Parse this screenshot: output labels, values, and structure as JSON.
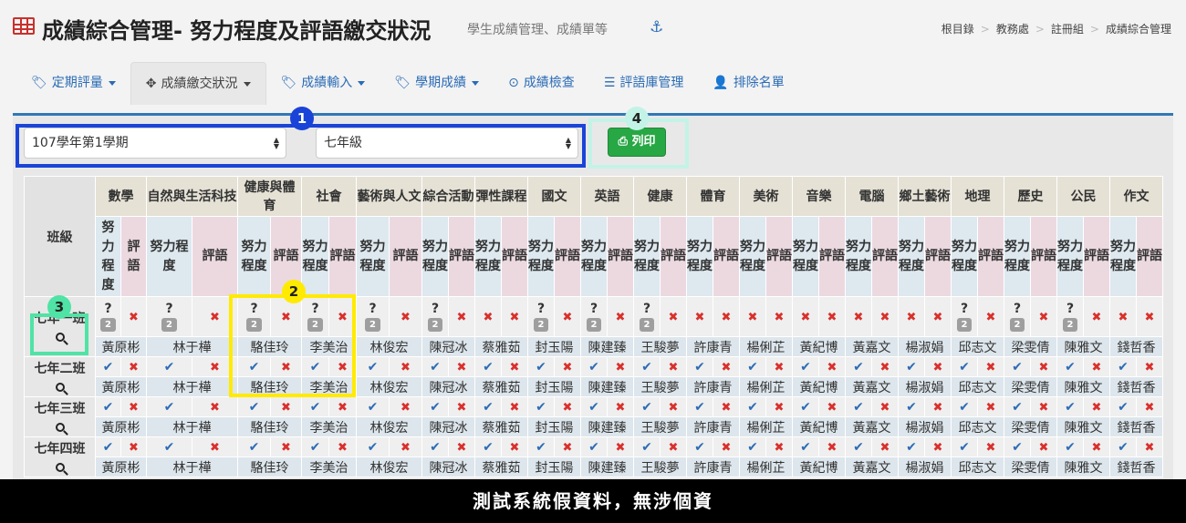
{
  "header": {
    "title": "成績綜合管理- 努力程度及評語繳交狀況",
    "subtitle": "學生成績管理、成績單等",
    "breadcrumb": [
      "根目錄",
      "教務處",
      "註冊組",
      "成績綜合管理"
    ]
  },
  "tabs": [
    {
      "label": "定期評量",
      "icon": "tag-icon",
      "dropdown": true,
      "active": false
    },
    {
      "label": "成績繳交狀況",
      "icon": "crosshairs-icon",
      "dropdown": true,
      "active": true
    },
    {
      "label": "成績輸入",
      "icon": "tag-icon",
      "dropdown": true,
      "active": false
    },
    {
      "label": "學期成績",
      "icon": "tag-icon",
      "dropdown": true,
      "active": false
    },
    {
      "label": "成績檢查",
      "icon": "check-circle-icon",
      "dropdown": false,
      "active": false
    },
    {
      "label": "評語庫管理",
      "icon": "database-icon",
      "dropdown": false,
      "active": false
    },
    {
      "label": "排除名單",
      "icon": "user-times-icon",
      "dropdown": false,
      "active": false
    }
  ],
  "filters": {
    "semester": "107學年第1學期",
    "grade": "七年級"
  },
  "print_label": "列印",
  "badges": {
    "b1": "1",
    "b2": "2",
    "b3": "3",
    "b4": "4"
  },
  "table": {
    "class_header": "班級",
    "effort_label": "努力程度",
    "comment_label": "評語",
    "subjects": [
      "數學",
      "自然與生活科技",
      "健康與體育",
      "社會",
      "藝術與人文",
      "綜合活動",
      "彈性課程",
      "國文",
      "英語",
      "健康",
      "體育",
      "美術",
      "音樂",
      "電腦",
      "鄉土藝術",
      "地理",
      "歷史",
      "公民",
      "作文"
    ],
    "rows": [
      {
        "class": "七年一班",
        "marks": [
          "?2",
          "x",
          "?2",
          "x",
          "?2",
          "x",
          "?2",
          "x",
          "?2",
          "x",
          "?2",
          "x",
          "x",
          "x",
          "?2",
          "x",
          "?2",
          "x",
          "?2",
          "x",
          "x",
          "x",
          "x",
          "x",
          "x",
          "x",
          "x",
          "x",
          "x",
          "x",
          "?2",
          "x",
          "?2",
          "x",
          "?2",
          "x",
          "x",
          "x"
        ],
        "teachers": [
          "黃原彬",
          "林于樺",
          "駱佳玲",
          "李美治",
          "林俊宏",
          "陳冠冰",
          "蔡雅茹",
          "封玉陽",
          "陳建臻",
          "王駿夢",
          "許康青",
          "楊俐芷",
          "黃紀博",
          "黃嘉文",
          "楊淑娟",
          "邱志文",
          "梁雯倩",
          "陳雅文",
          "錢哲香"
        ]
      },
      {
        "class": "七年二班",
        "marks": [
          "v",
          "x",
          "v",
          "x",
          "v",
          "x",
          "v",
          "x",
          "v",
          "x",
          "v",
          "x",
          "v",
          "x",
          "v",
          "x",
          "v",
          "x",
          "v",
          "x",
          "v",
          "x",
          "v",
          "x",
          "v",
          "x",
          "v",
          "x",
          "v",
          "x",
          "v",
          "x",
          "v",
          "x",
          "v",
          "x",
          "v",
          "x"
        ],
        "teachers": [
          "黃原彬",
          "林于樺",
          "駱佳玲",
          "李美治",
          "林俊宏",
          "陳冠冰",
          "蔡雅茹",
          "封玉陽",
          "陳建臻",
          "王駿夢",
          "許康青",
          "楊俐芷",
          "黃紀博",
          "黃嘉文",
          "楊淑娟",
          "邱志文",
          "梁雯倩",
          "陳雅文",
          "錢哲香"
        ]
      },
      {
        "class": "七年三班",
        "marks": [
          "v",
          "x",
          "v",
          "x",
          "v",
          "x",
          "v",
          "x",
          "v",
          "x",
          "v",
          "x",
          "v",
          "x",
          "v",
          "x",
          "v",
          "x",
          "v",
          "x",
          "v",
          "x",
          "v",
          "x",
          "v",
          "x",
          "v",
          "x",
          "v",
          "x",
          "v",
          "x",
          "v",
          "x",
          "v",
          "x",
          "v",
          "x"
        ],
        "teachers": [
          "黃原彬",
          "林于樺",
          "駱佳玲",
          "李美治",
          "林俊宏",
          "陳冠冰",
          "蔡雅茹",
          "封玉陽",
          "陳建臻",
          "王駿夢",
          "許康青",
          "楊俐芷",
          "黃紀博",
          "黃嘉文",
          "楊淑娟",
          "邱志文",
          "梁雯倩",
          "陳雅文",
          "錢哲香"
        ]
      },
      {
        "class": "七年四班",
        "marks": [
          "v",
          "x",
          "v",
          "x",
          "v",
          "x",
          "v",
          "x",
          "v",
          "x",
          "v",
          "x",
          "v",
          "x",
          "v",
          "x",
          "v",
          "x",
          "v",
          "x",
          "v",
          "x",
          "v",
          "x",
          "v",
          "x",
          "v",
          "x",
          "v",
          "x",
          "v",
          "x",
          "v",
          "x",
          "v",
          "x",
          "v",
          "x"
        ],
        "teachers": [
          "黃原彬",
          "林于樺",
          "駱佳玲",
          "李美治",
          "林俊宏",
          "陳冠冰",
          "蔡雅茹",
          "封玉陽",
          "陳建臻",
          "王駿夢",
          "許康青",
          "楊俐芷",
          "黃紀博",
          "黃嘉文",
          "楊淑娟",
          "邱志文",
          "梁雯倩",
          "陳雅文",
          "錢哲香"
        ]
      }
    ]
  },
  "footer_text": "測試系統假資料，無涉個資"
}
